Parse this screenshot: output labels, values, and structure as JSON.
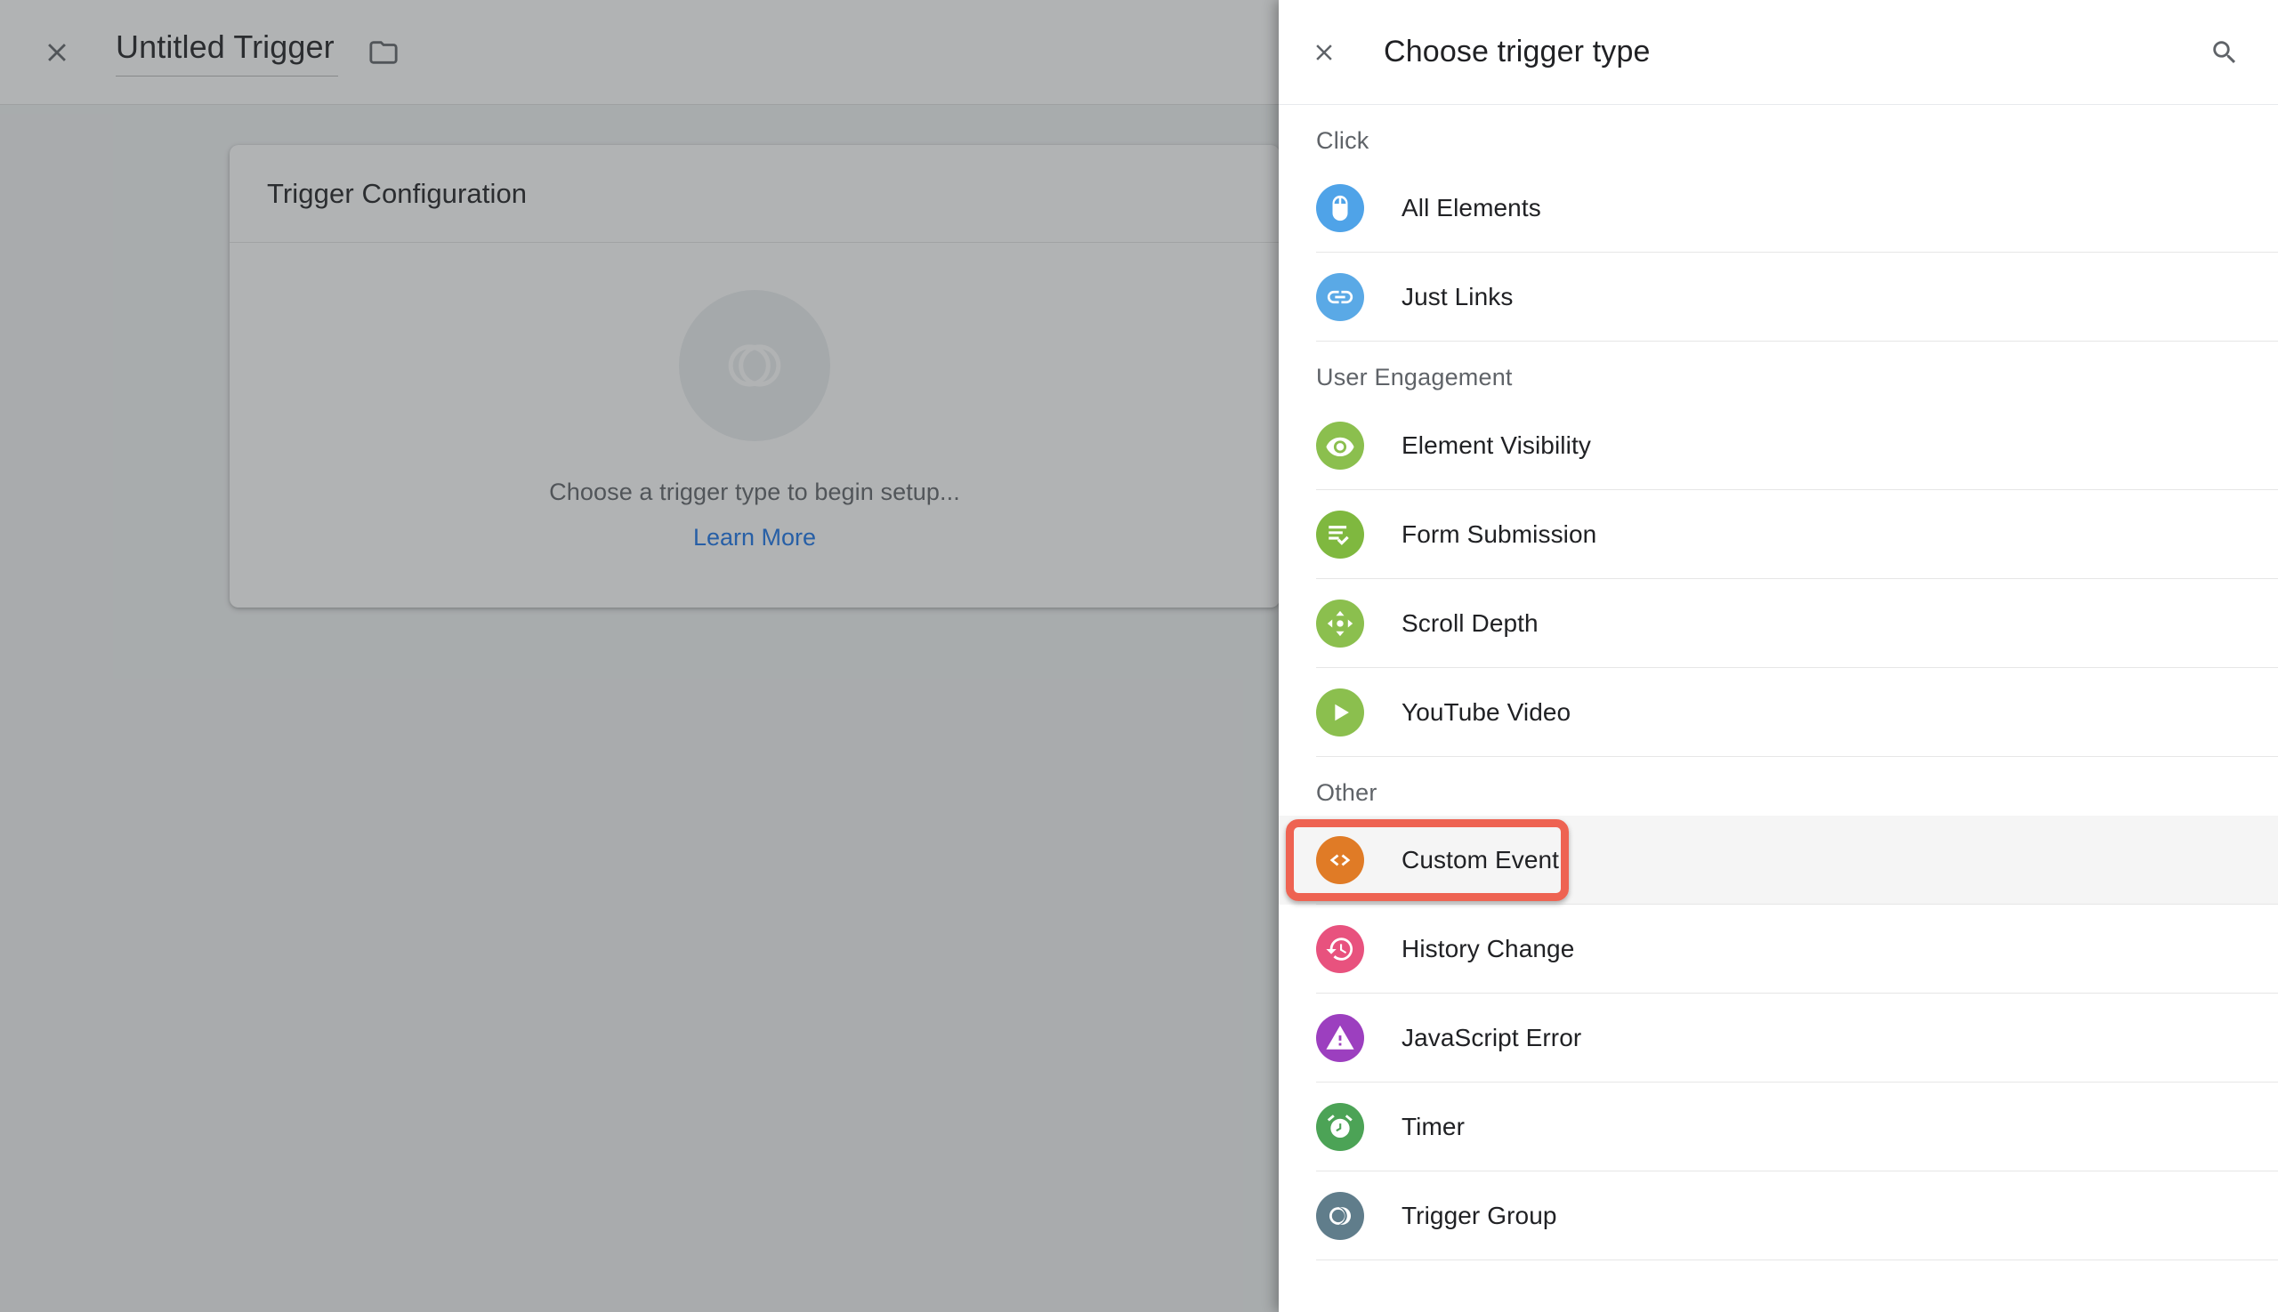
{
  "editor": {
    "close_label": "Close trigger editor",
    "trigger_name": "Untitled Trigger",
    "folder_icon": "folder-icon",
    "close_icon": "close-icon",
    "card": {
      "title": "Trigger Configuration",
      "empty_icon": "trigger-placeholder-icon",
      "empty_text": "Choose a trigger type to begin setup...",
      "learn_more_label": "Learn More",
      "learn_more_color": "#1a73e8"
    }
  },
  "panel": {
    "close_icon": "close-icon",
    "title": "Choose trigger type",
    "search_icon": "search-icon",
    "groups": [
      {
        "label": "Click",
        "items": [
          {
            "label": "All Elements",
            "icon": "mouse-icon",
            "color": "#4fa3e8",
            "hovered": false
          },
          {
            "label": "Just Links",
            "icon": "link-icon",
            "color": "#5aa9e6",
            "hovered": false
          }
        ]
      },
      {
        "label": "User Engagement",
        "items": [
          {
            "label": "Element Visibility",
            "icon": "eye-icon",
            "color": "#8bbf4e",
            "hovered": false
          },
          {
            "label": "Form Submission",
            "icon": "form-check-icon",
            "color": "#7fb83f",
            "hovered": false
          },
          {
            "label": "Scroll Depth",
            "icon": "scroll-arrows-icon",
            "color": "#8bbf4e",
            "hovered": false
          },
          {
            "label": "YouTube Video",
            "icon": "play-icon",
            "color": "#8bbf4e",
            "hovered": false
          }
        ]
      },
      {
        "label": "Other",
        "items": [
          {
            "label": "Custom Event",
            "icon": "code-brackets-icon",
            "color": "#e07b26",
            "hovered": true
          },
          {
            "label": "History Change",
            "icon": "history-clock-icon",
            "color": "#e8527e",
            "hovered": false
          },
          {
            "label": "JavaScript Error",
            "icon": "warning-icon",
            "color": "#9c3fbf",
            "hovered": false
          },
          {
            "label": "Timer",
            "icon": "alarm-clock-icon",
            "color": "#4ca356",
            "hovered": false
          },
          {
            "label": "Trigger Group",
            "icon": "trigger-group-icon",
            "color": "#607d8b",
            "hovered": false
          }
        ]
      }
    ]
  },
  "annotation": {
    "target_label": "Custom Event",
    "highlight_color": "#ee6352"
  }
}
